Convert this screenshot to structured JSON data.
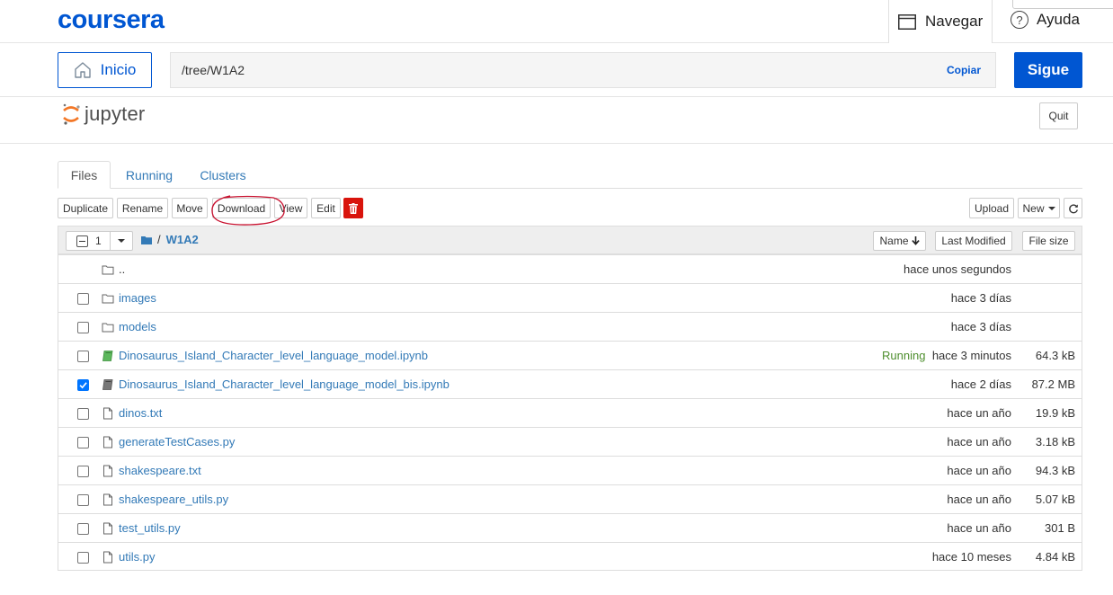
{
  "coursera": {
    "logo": "coursera",
    "nav_label": "Navegar",
    "help_label": "Ayuda",
    "help_glyph": "?"
  },
  "lab_bar": {
    "home_label": "Inicio",
    "path": "/tree/W1A2",
    "copy_label": "Copiar",
    "next_label": "Sigue"
  },
  "jupyter": {
    "logo_text": "jupyter",
    "quit_label": "Quit"
  },
  "tabs": [
    {
      "label": "Files",
      "active": true
    },
    {
      "label": "Running",
      "active": false
    },
    {
      "label": "Clusters",
      "active": false
    }
  ],
  "toolbar": {
    "duplicate": "Duplicate",
    "rename": "Rename",
    "move": "Move",
    "download": "Download",
    "view": "View",
    "edit": "Edit",
    "upload": "Upload",
    "new": "New"
  },
  "list_header": {
    "selected_count": "1",
    "breadcrumb_sep": "/",
    "folder": "W1A2",
    "sort_name": "Name",
    "sort_modified": "Last Modified",
    "sort_size": "File size"
  },
  "rows": [
    {
      "type": "folder",
      "name": "..",
      "status": "",
      "modified": "hace unos segundos",
      "size": "",
      "checkbox": false,
      "checked": false
    },
    {
      "type": "folder",
      "name": "images",
      "status": "",
      "modified": "hace 3 días",
      "size": "",
      "checkbox": true,
      "checked": false
    },
    {
      "type": "folder",
      "name": "models",
      "status": "",
      "modified": "hace 3 días",
      "size": "",
      "checkbox": true,
      "checked": false
    },
    {
      "type": "notebook-running",
      "name": "Dinosaurus_Island_Character_level_language_model.ipynb",
      "status": "Running",
      "modified": "hace 3 minutos",
      "size": "64.3 kB",
      "checkbox": true,
      "checked": false
    },
    {
      "type": "notebook",
      "name": "Dinosaurus_Island_Character_level_language_model_bis.ipynb",
      "status": "",
      "modified": "hace 2 días",
      "size": "87.2 MB",
      "checkbox": true,
      "checked": true
    },
    {
      "type": "file",
      "name": "dinos.txt",
      "status": "",
      "modified": "hace un año",
      "size": "19.9 kB",
      "checkbox": true,
      "checked": false
    },
    {
      "type": "file",
      "name": "generateTestCases.py",
      "status": "",
      "modified": "hace un año",
      "size": "3.18 kB",
      "checkbox": true,
      "checked": false
    },
    {
      "type": "file",
      "name": "shakespeare.txt",
      "status": "",
      "modified": "hace un año",
      "size": "94.3 kB",
      "checkbox": true,
      "checked": false
    },
    {
      "type": "file",
      "name": "shakespeare_utils.py",
      "status": "",
      "modified": "hace un año",
      "size": "5.07 kB",
      "checkbox": true,
      "checked": false
    },
    {
      "type": "file",
      "name": "test_utils.py",
      "status": "",
      "modified": "hace un año",
      "size": "301 B",
      "checkbox": true,
      "checked": false
    },
    {
      "type": "file",
      "name": "utils.py",
      "status": "",
      "modified": "hace 10 meses",
      "size": "4.84 kB",
      "checkbox": true,
      "checked": false
    }
  ],
  "colors": {
    "coursera_blue": "#0056d2",
    "link_blue": "#337ab7",
    "running_green": "#4f8f2f",
    "delete_red": "#d9140c",
    "annotation_red": "#c8102e",
    "jupyter_orange": "#f37726"
  }
}
